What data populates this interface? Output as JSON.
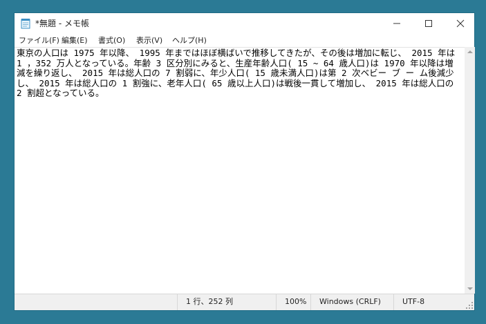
{
  "window": {
    "title": "*無題 - メモ帳"
  },
  "menu": {
    "items": [
      "ファイル(F)",
      "編集(E)",
      "書式(O)",
      "表示(V)",
      "ヘルプ(H)"
    ]
  },
  "editor": {
    "content": "東京の人口は 1975 年以降、 1995 年まではほぼ横ばいで推移してきたが、その後は増加に転じ、 2015 年は 1 ，352 万人となっている。年齢 3 区分別にみると、生産年齢人口( 15 ~ 64 歳人口)は 1970 年以降は増減を繰り返し、 2015 年は総人口の 7 割弱に、年少人口( 15 歳未満人口)は第 2 次ベビー ブ ー ム後減少し、 2015 年は総人口の 1 割強に、老年人口( 65 歳以上人口)は戦後一貫して増加し、 2015 年は総人口の 2 割超となっている。"
  },
  "status": {
    "position": "1 行、252 列",
    "zoom": "100%",
    "line_ending": "Windows (CRLF)",
    "encoding": "UTF-8"
  },
  "colors": {
    "desktop": "#2b7a95",
    "window_border": "#1f6b85",
    "statusbar": "#f0f0f0"
  }
}
